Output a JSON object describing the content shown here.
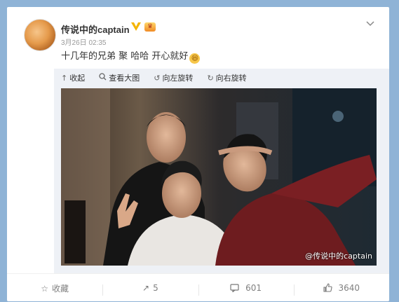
{
  "post": {
    "username": "传说中的captain",
    "verified_icon": "v-badge-icon",
    "crown_icon": "crown-badge-icon",
    "date": "3月26日 02:35",
    "text": "十几年的兄弟 聚  哈哈 开心就好",
    "text_emoji": "laugh-emoji-icon"
  },
  "image_tools": {
    "collapse": "收起",
    "view_large": "查看大图",
    "rotate_left": "向左旋转",
    "rotate_right": "向右旋转"
  },
  "photo": {
    "watermark": "@传说中的captain"
  },
  "footer": {
    "favorite": "收藏",
    "repost_count": "5",
    "comment_count": "601",
    "like_count": "3640"
  },
  "colors": {
    "page_background": "#8fb3d6",
    "card_background": "#ffffff",
    "text_primary": "#333333",
    "text_secondary": "#999999"
  }
}
